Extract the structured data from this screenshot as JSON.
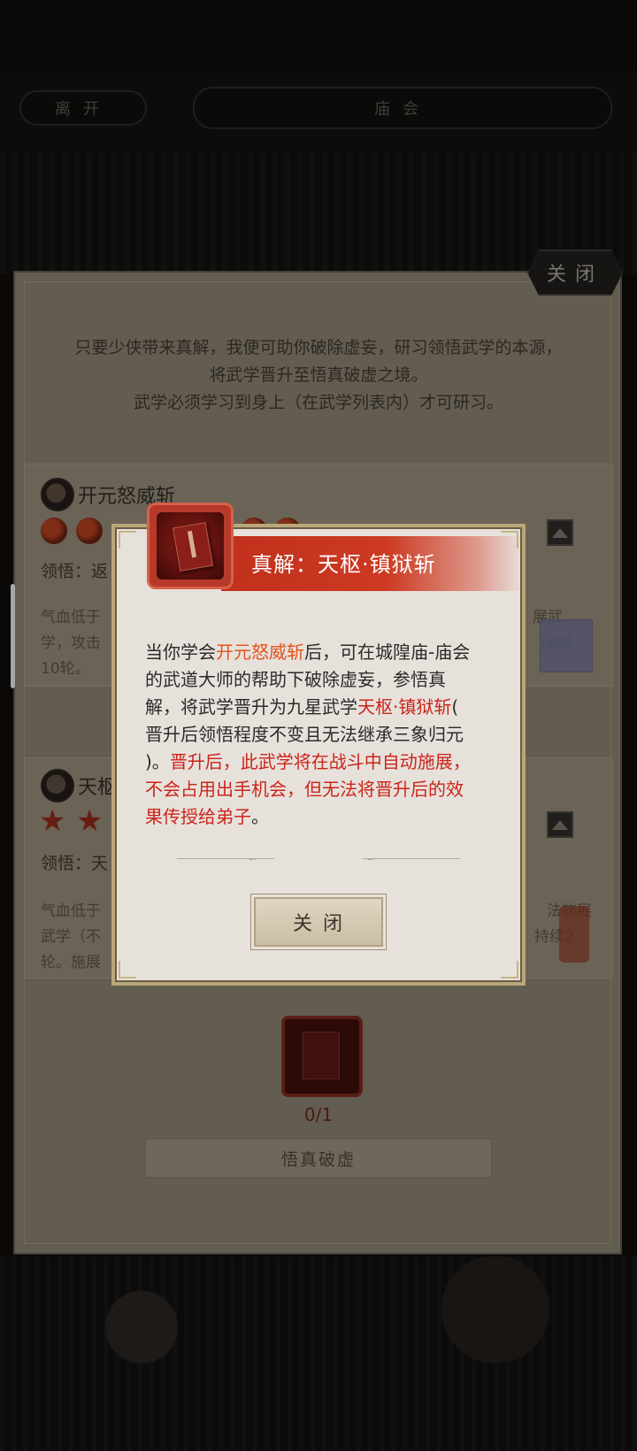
{
  "header": {
    "leave_label": "离开",
    "title": "庙会"
  },
  "panel": {
    "close_label": "关闭",
    "intro_lines": [
      "只要少侠带来真解，我便可助你破除虚妄，研习领悟武学的本源，",
      "将武学晋升至悟真破虚之境。",
      "武学必须学习到身上（在武学列表内）才可研习。"
    ],
    "skill1": {
      "name": "开元怒威斩",
      "comprehension_label": "领悟：返",
      "desc_left": [
        "气血低于",
        "学，攻击",
        "10轮。"
      ],
      "desc_right": [
        "展武",
        "间隔"
      ]
    },
    "skill2": {
      "name": "天枢",
      "comprehension_label": "领悟：天",
      "desc_left": [
        "气血低于",
        "武学（不",
        "轮。施展"
      ],
      "desc_right": [
        "法施展",
        "持续2"
      ]
    },
    "counter": "0/1",
    "breakthrough_label": "悟真破虚"
  },
  "dialog": {
    "title": "真解：天枢·镇狱斩",
    "body": {
      "l1_a": "当你学会",
      "l1_b": "开元怒威斩",
      "l1_c": "后，可在城隍庙-庙会",
      "l2": "的武道大师的帮助下破除虚妄，参悟真",
      "l3_a": "解，将武学晋升为九星武学",
      "l3_b": "天枢·镇狱斩",
      "l3_c": "(",
      "l4": "晋升后领悟程度不变且无法继承三象归元",
      "l5_a": ")。",
      "l5_b": "晋升后，此武学将在战斗中自动施展，",
      "l6": "不会占用出手机会，但无法将晋升后的效",
      "l7_a": "果传授给弟子",
      "l7_b": "。"
    },
    "close_label": "关闭"
  },
  "colors": {
    "highlight_orange": "#e0541c",
    "highlight_red": "#cc2418",
    "ribbon_red": "#c0301c"
  }
}
